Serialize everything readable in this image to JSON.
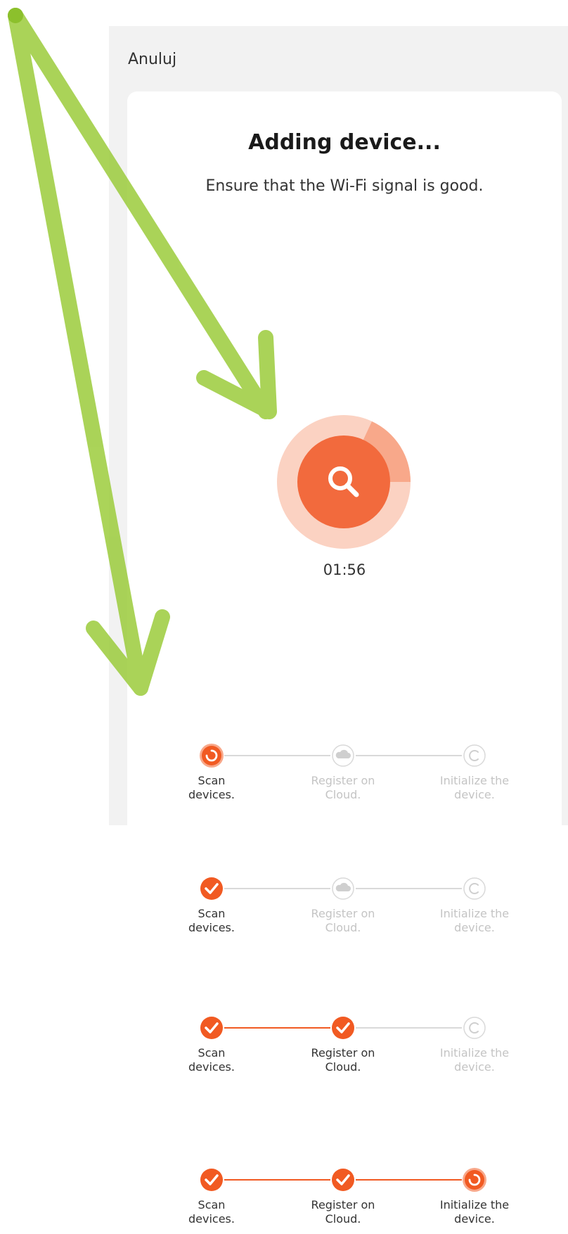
{
  "header": {
    "cancel_label": "Anuluj"
  },
  "card": {
    "title": "Adding device...",
    "subtitle": "Ensure that the Wi-Fi signal is good.",
    "timer": "01:56",
    "scanner_icon": "search-icon"
  },
  "step_labels": [
    {
      "line1": "Scan",
      "line2": "devices."
    },
    {
      "line1": "Register on",
      "line2": "Cloud."
    },
    {
      "line1": "Initialize the",
      "line2": "device."
    }
  ],
  "progress_states": [
    [
      "active",
      "pending",
      "pending"
    ],
    [
      "done",
      "pending",
      "pending"
    ],
    [
      "done",
      "done",
      "pending"
    ],
    [
      "done",
      "done",
      "active"
    ]
  ],
  "colors": {
    "accent": "#f15a22",
    "accent_light": "#f8a88a",
    "pending": "#d9d9d9",
    "annotation_arrow": "#9ccc3c"
  }
}
